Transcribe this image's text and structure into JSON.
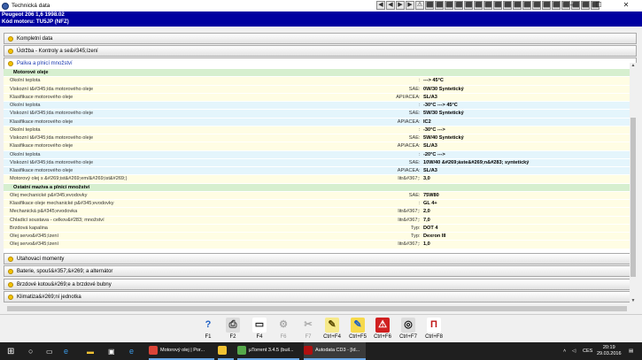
{
  "window": {
    "title": "Technická data",
    "minimize": "–",
    "maximize": "☐",
    "close": "✕"
  },
  "toolbar": [
    "◀",
    "◀",
    "▶",
    "▶",
    "⚠",
    "⬛",
    "⬛",
    "⬛",
    "⬛",
    "⬛",
    "⬛",
    "⬛",
    "⬛",
    "⬛",
    "⬛",
    "⬛",
    "⬛",
    "⬛",
    "⬛",
    "⬛",
    "⬛",
    "⬛",
    "⬛"
  ],
  "vehicle": {
    "line1": "Peugeot  206  1,6  1998.02",
    "line2": "Kód motoru: TU5JP (NFZ)"
  },
  "sections": {
    "kompletni": "Kompletní data",
    "udrzba": "Údržba - Kontroly a se&#345;ízení",
    "paliva": "Paliva a plnicí množství",
    "utahovaci": "Utahovací momenty",
    "baterie": "Baterie, spouš&#357;&#269; a alternátor",
    "brzdove": "Brzdové kotou&#269;e a brzdové bubny",
    "klimatizace": "Klimatiza&#269;ní jednotka"
  },
  "rows": [
    {
      "t": "grp",
      "label": "Motorové oleje",
      "unit": "",
      "value": ""
    },
    {
      "t": "a",
      "label": "Okolní teplota",
      "unit": "",
      "value": "---> 45°C"
    },
    {
      "t": "a",
      "label": "Viskozní t&#345;ída motorového oleje",
      "unit": "SAE",
      "value": "0W/30 Syntetický"
    },
    {
      "t": "a",
      "label": "Klasifikace motorového oleje",
      "unit": "API/ACEA",
      "value": "SL/A3"
    },
    {
      "t": "b",
      "label": "Okolní teplota",
      "unit": "",
      "value": "-30°C ---> 45°C"
    },
    {
      "t": "b",
      "label": "Viskozní t&#345;ída motorového oleje",
      "unit": "SAE",
      "value": "5W/30 Syntetický"
    },
    {
      "t": "b",
      "label": "Klasifikace motorového oleje",
      "unit": "APIACEA",
      "value": "IC2"
    },
    {
      "t": "a",
      "label": "Okolní teplota",
      "unit": "",
      "value": "-30°C --->"
    },
    {
      "t": "a",
      "label": "Viskozní t&#345;ída motorového oleje",
      "unit": "SAE",
      "value": "5W/40 Syntetický"
    },
    {
      "t": "a",
      "label": "Klasifikace motorového oleje",
      "unit": "APIACEA",
      "value": "SL/A3"
    },
    {
      "t": "b",
      "label": "Okolní teplota",
      "unit": "",
      "value": "-20°C --->"
    },
    {
      "t": "b",
      "label": "Viskozní t&#345;ída motorového oleje",
      "unit": "SAE",
      "value": "10W/40 &#269;áste&#269;n&#283; syntetický"
    },
    {
      "t": "b",
      "label": "Klasifikace motorového oleje",
      "unit": "APIACEA",
      "value": "SL/A3"
    },
    {
      "t": "a",
      "label": "Motorový olej s &#269;ist&#269;em/&#269;ist&#269;)",
      "unit": "litr&#367;",
      "value": "3,0"
    },
    {
      "t": "grp",
      "label": "Ostatní maziva a plnicí množství",
      "unit": "",
      "value": ""
    },
    {
      "t": "a",
      "label": "Olej mechanické p&#345;evodovky",
      "unit": "SAE",
      "value": "75W80"
    },
    {
      "t": "a",
      "label": "Klasifikace oleje mechanické p&#345;evodovky",
      "unit": "",
      "value": "GL 4+"
    },
    {
      "t": "a",
      "label": "Mechanická p&#345;evodovka",
      "unit": "litr&#367;",
      "value": "2,0"
    },
    {
      "t": "a",
      "label": "Chladicí soustava - celkov&#283; množství",
      "unit": "litr&#367;",
      "value": "7,0"
    },
    {
      "t": "a",
      "label": "Brzdová kapalina",
      "unit": "Typ",
      "value": "DOT 4"
    },
    {
      "t": "a",
      "label": "Olej servo&#345;ízení",
      "unit": "Typ",
      "value": "Dexron III"
    },
    {
      "t": "a",
      "label": "Olej servo&#345;ízení",
      "unit": "litr&#367;",
      "value": "1,0"
    }
  ],
  "fkeys": [
    {
      "label": "F1",
      "icon": "?",
      "color": "#1d5fc4",
      "bg": "transparent",
      "disabled": false
    },
    {
      "label": "F2",
      "icon": "⎙",
      "color": "#333",
      "bg": "#dcdcdc",
      "disabled": false
    },
    {
      "label": "F4",
      "icon": "▭",
      "color": "#222",
      "bg": "#ffffff",
      "disabled": false
    },
    {
      "label": "F6",
      "icon": "⚙",
      "color": "#aaa",
      "bg": "transparent",
      "disabled": true
    },
    {
      "label": "F7",
      "icon": "✂",
      "color": "#aaa",
      "bg": "transparent",
      "disabled": true
    },
    {
      "label": "Ctrl+F4",
      "icon": "✎",
      "color": "#5a4a00",
      "bg": "#f6e98a",
      "disabled": false
    },
    {
      "label": "Ctrl+F5",
      "icon": "✎",
      "color": "#1d5fc4",
      "bg": "#f6d94c",
      "disabled": false
    },
    {
      "label": "Ctrl+F6",
      "icon": "⚠",
      "color": "#fff",
      "bg": "#d02020",
      "disabled": false
    },
    {
      "label": "Ctrl+F7",
      "icon": "◎",
      "color": "#111",
      "bg": "#dcdcdc",
      "disabled": false
    },
    {
      "label": "Ctrl+F8",
      "icon": "Π",
      "color": "#c01818",
      "bg": "#ffffff",
      "disabled": false
    }
  ],
  "taskbar": {
    "apps": [
      {
        "label": "Motorový olej | Por...",
        "color": "#db4437"
      },
      {
        "label": "",
        "color": "#f1c232"
      },
      {
        "label": "µTorrent 3.4.5  (buil...",
        "color": "#56a84b"
      },
      {
        "label": "Autodata CD3 - [Id...",
        "color": "#b01010"
      }
    ],
    "lang": "CES",
    "time": "20:19",
    "date": "29.03.2016"
  }
}
